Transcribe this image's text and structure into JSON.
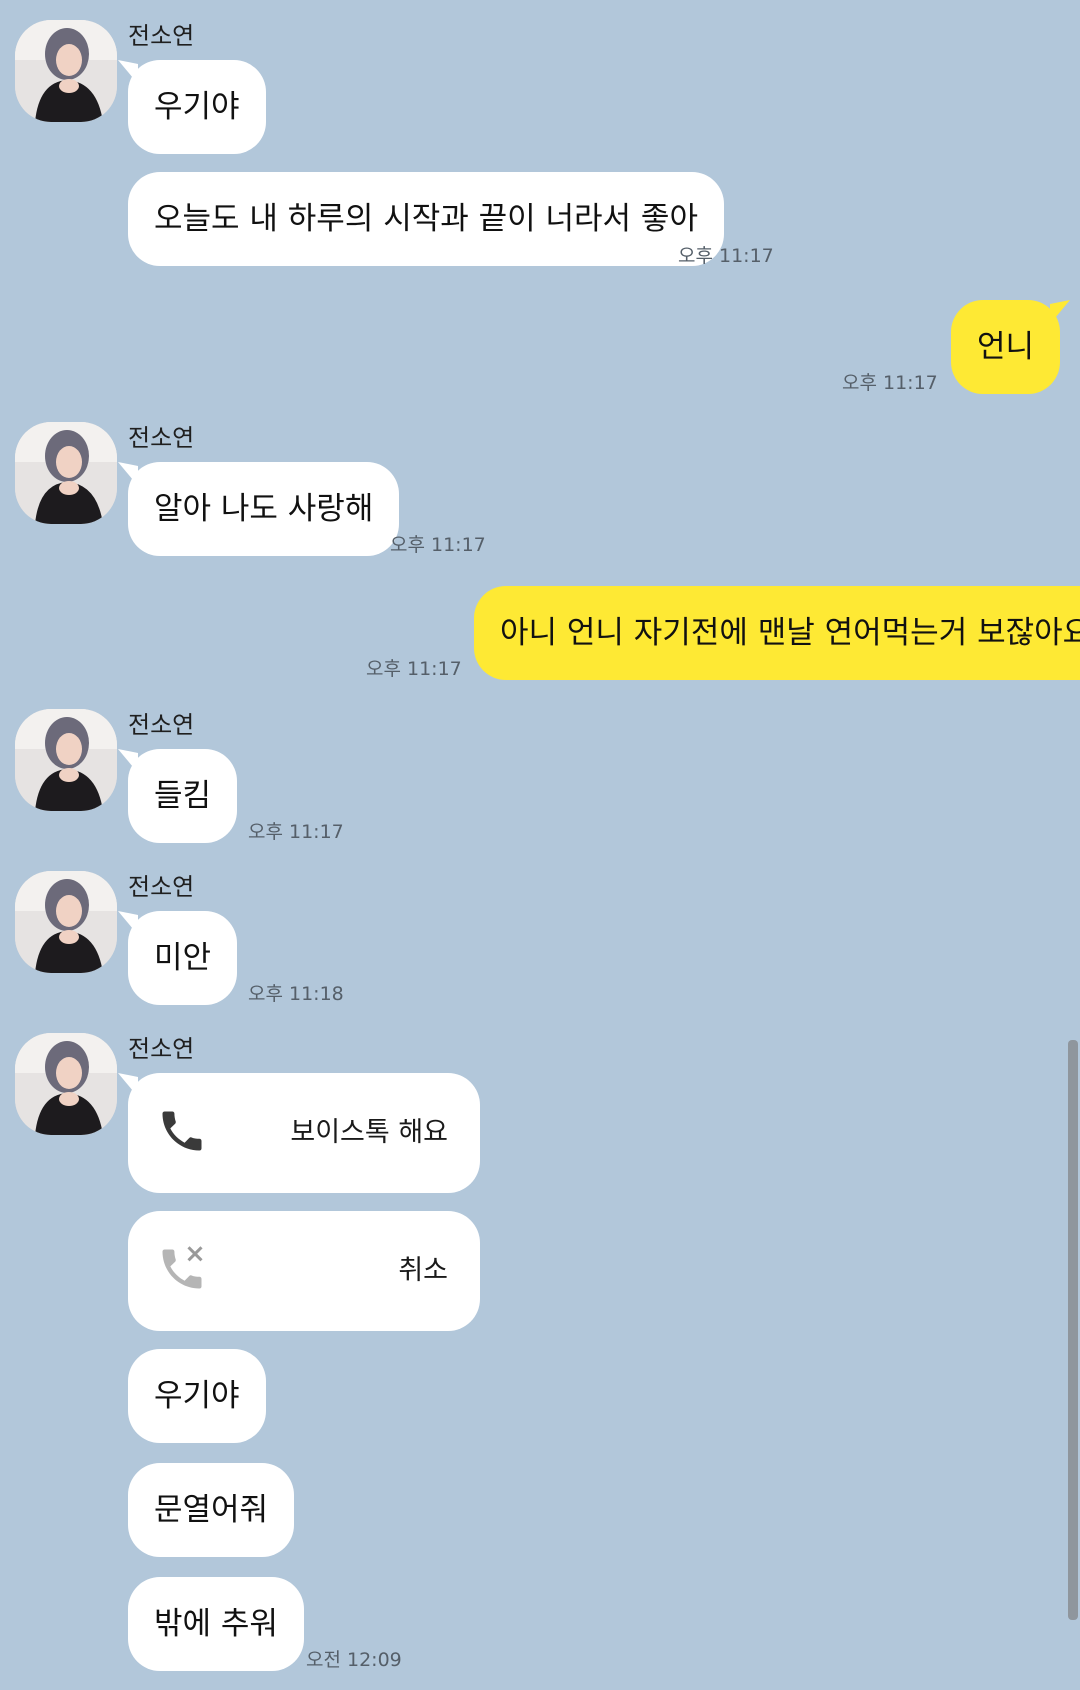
{
  "contact": {
    "name": "전소연"
  },
  "messages": {
    "m1": "우기야",
    "m2": "오늘도 내 하루의 시작과 끝이 너라서 좋아",
    "m2_time": "오후 11:17",
    "me1": "언니",
    "me1_time": "오후 11:17",
    "m3": "알아 나도 사랑해",
    "m3_time": "오후 11:17",
    "me2": "아니 언니 자기전에 맨날 연어먹는거 보잖아요",
    "me2_time": "오후 11:17",
    "m4": "들킴",
    "m4_time": "오후 11:17",
    "m5": "미안",
    "m5_time": "오후 11:18",
    "call1": "보이스톡 해요",
    "call2": "취소",
    "m6": "우기야",
    "m7": "문열어줘",
    "m8": "밖에 추워",
    "m8_time": "오전 12:09"
  },
  "colors": {
    "background": "#b2c7da",
    "incoming_bubble": "#ffffff",
    "outgoing_bubble": "#fee934"
  },
  "icons": {
    "avatar": "profile-photo",
    "voice_call": "phone-icon",
    "cancelled_call": "phone-cancel-icon"
  }
}
